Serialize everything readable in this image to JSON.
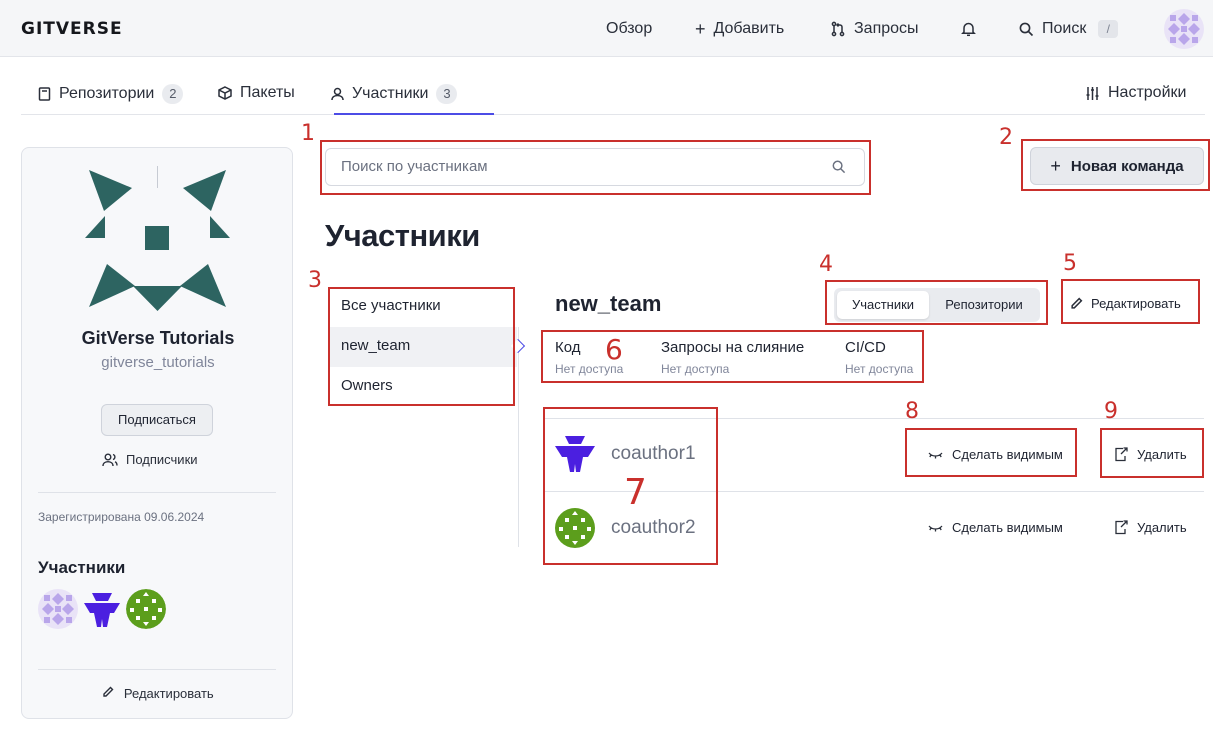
{
  "header": {
    "logo": "GITVERSE",
    "nav": {
      "overview": "Обзор",
      "add": "Добавить",
      "requests": "Запросы",
      "search": "Поиск",
      "search_shortcut": "/"
    }
  },
  "tabs": [
    {
      "label": "Репозитории",
      "count": "2"
    },
    {
      "label": "Пакеты"
    },
    {
      "label": "Участники",
      "count": "3",
      "active": true
    }
  ],
  "settings_label": "Настройки",
  "org": {
    "name": "GitVerse Tutorials",
    "login": "gitverse_tutorials",
    "subscribe_label": "Подписаться",
    "followers_label": "Подписчики",
    "registered": "Зарегистрирована 09.06.2024",
    "members_heading": "Участники",
    "edit_label": "Редактировать"
  },
  "search": {
    "placeholder": "Поиск по участникам"
  },
  "new_team_label": "Новая команда",
  "page_title": "Участники",
  "team_list": [
    "Все участники",
    "new_team",
    "Owners"
  ],
  "team": {
    "name": "new_team",
    "segments": [
      "Участники",
      "Репозитории"
    ],
    "edit_label": "Редактировать",
    "permissions": [
      {
        "title": "Код",
        "value": "Нет доступа"
      },
      {
        "title": "Запросы на слияние",
        "value": "Нет доступа"
      },
      {
        "title": "CI/CD",
        "value": "Нет доступа"
      }
    ],
    "members": [
      {
        "name": "coauthor1",
        "make_visible": "Сделать видимым",
        "remove": "Удалить"
      },
      {
        "name": "coauthor2",
        "make_visible": "Сделать видимым",
        "remove": "Удалить"
      }
    ]
  },
  "annotations": [
    "1",
    "2",
    "3",
    "4",
    "5",
    "6",
    "7",
    "8",
    "9"
  ],
  "colors": {
    "accent": "#4c4ce6",
    "annotation": "#c9302c",
    "org_logo": "#2d6461",
    "avatar1": "#4b1fe0",
    "avatar2": "#5c9e1c"
  }
}
